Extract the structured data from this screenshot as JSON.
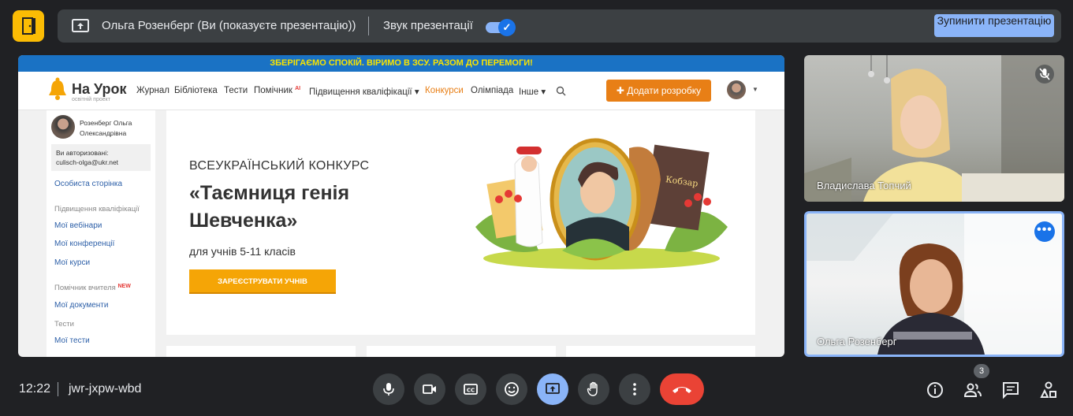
{
  "top_bar": {
    "presenter_text": "Ольга Розенберг (Ви (показуєте презентацію))",
    "sound_label": "Звук презентації",
    "sound_enabled": true,
    "stop_button": "Зупинити презентацію",
    "icons": [
      "door-icon",
      "present-screen-icon",
      "check-icon"
    ]
  },
  "shared_screen": {
    "banner": "ЗБЕРІГАЄМО СПОКІЙ. ВІРИМО В ЗСУ. РАЗОМ ДО ПЕРЕМОГИ!",
    "logo": {
      "title": "На Урок",
      "subtitle": "освітній проект"
    },
    "nav": [
      "Журнал",
      "Бібліотека",
      "Тести",
      "Помічник",
      "Підвищення кваліфікації ▾",
      "Конкурси",
      "Олімпіада",
      "Інше ▾"
    ],
    "ai_tag": "AI",
    "add_button": "✚ Додати розробку",
    "sidebar": {
      "user_name": "Розенберг Ольга Олександрівна",
      "auth_label": "Ви авторизовані:",
      "auth_email": "culisch-olga@ukr.net",
      "personal_page": "Особиста сторінка",
      "section_qual": "Підвищення кваліфікації",
      "webinars": "Мої вебінари",
      "conferences": "Мої конференції",
      "courses": "Мої курси",
      "section_helper": "Помічник вчителя",
      "new_tag": "NEW",
      "documents": "Мої документи",
      "section_tests": "Тести",
      "my_tests": "Мої тести"
    },
    "contest": {
      "subtitle": "ВСЕУКРАЇНСЬКИЙ КОНКУРС",
      "title": "«Таємниця генія Шевченка»",
      "grades": "для учнів 5-11 класів",
      "register_button": "ЗАРЕЄСТРУВАТИ УЧНІВ",
      "book_title": "Кобзар"
    }
  },
  "participants": [
    {
      "name": "Владислава Топчий",
      "muted": true
    },
    {
      "name": "Ольга Розенберг",
      "active": true
    }
  ],
  "bottom_bar": {
    "time": "12:22",
    "meeting_code": "jwr-jxpw-wbd",
    "participant_count": "3",
    "controls": [
      "mic-icon",
      "camera-icon",
      "captions-icon",
      "emoji-icon",
      "present-icon",
      "raise-hand-icon",
      "more-options-icon",
      "hang-up-icon"
    ],
    "right_icons": [
      "info-icon",
      "people-icon",
      "chat-icon",
      "activities-icon"
    ]
  },
  "colors": {
    "accent": "#8ab4f8",
    "brand_orange": "#e87f16",
    "hangup": "#ea4335",
    "door": "#fbbc04"
  }
}
